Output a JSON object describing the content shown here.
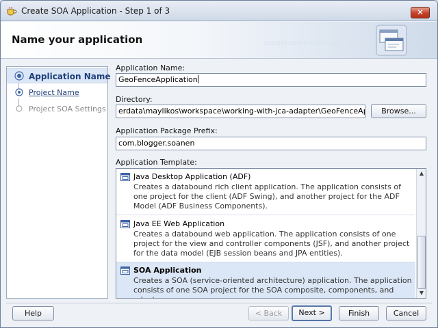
{
  "window": {
    "title": "Create SOA Application - Step 1 of 3",
    "close_glyph": "✕"
  },
  "header": {
    "title": "Name your application",
    "decoration": "010101010101010101010101 01010101"
  },
  "nav": {
    "items": [
      {
        "label": "Application Name",
        "state": "active"
      },
      {
        "label": "Project Name",
        "state": "link"
      },
      {
        "label": "Project SOA Settings",
        "state": "disabled"
      }
    ]
  },
  "form": {
    "app_name_label": "Application Name:",
    "app_name_value": "GeoFenceApplication",
    "directory_label": "Directory:",
    "directory_value": "erdata\\maylikos\\workspace\\working-with-jca-adapter\\GeoFenceApplication",
    "browse_label": "Browse...",
    "package_label": "Application Package Prefix:",
    "package_value": "com.blogger.soanen",
    "template_label": "Application Template:"
  },
  "templates": [
    {
      "title": "Java Desktop Application (ADF)",
      "desc": "Creates a databound rich client application. The application consists of one project for the client (ADF Swing), and another project for the ADF Model (ADF Business Components).",
      "selected": false
    },
    {
      "title": "Java EE Web Application",
      "desc": "Creates a databound web application. The application consists of one project for the view and controller components (JSF), and another project for the data model (EJB session beans and JPA entities).",
      "selected": false
    },
    {
      "title": "SOA Application",
      "desc": "Creates a SOA (service-oriented architecture) application. The application consists of one SOA project for the SOA composite, components, and adapters.",
      "selected": true
    }
  ],
  "footer": {
    "help": "Help",
    "back": "< Back",
    "next": "Next >",
    "finish": "Finish",
    "cancel": "Cancel"
  },
  "colors": {
    "accent": "#1f3f7a",
    "selection": "#dbe7f6",
    "close": "#c4412a"
  }
}
